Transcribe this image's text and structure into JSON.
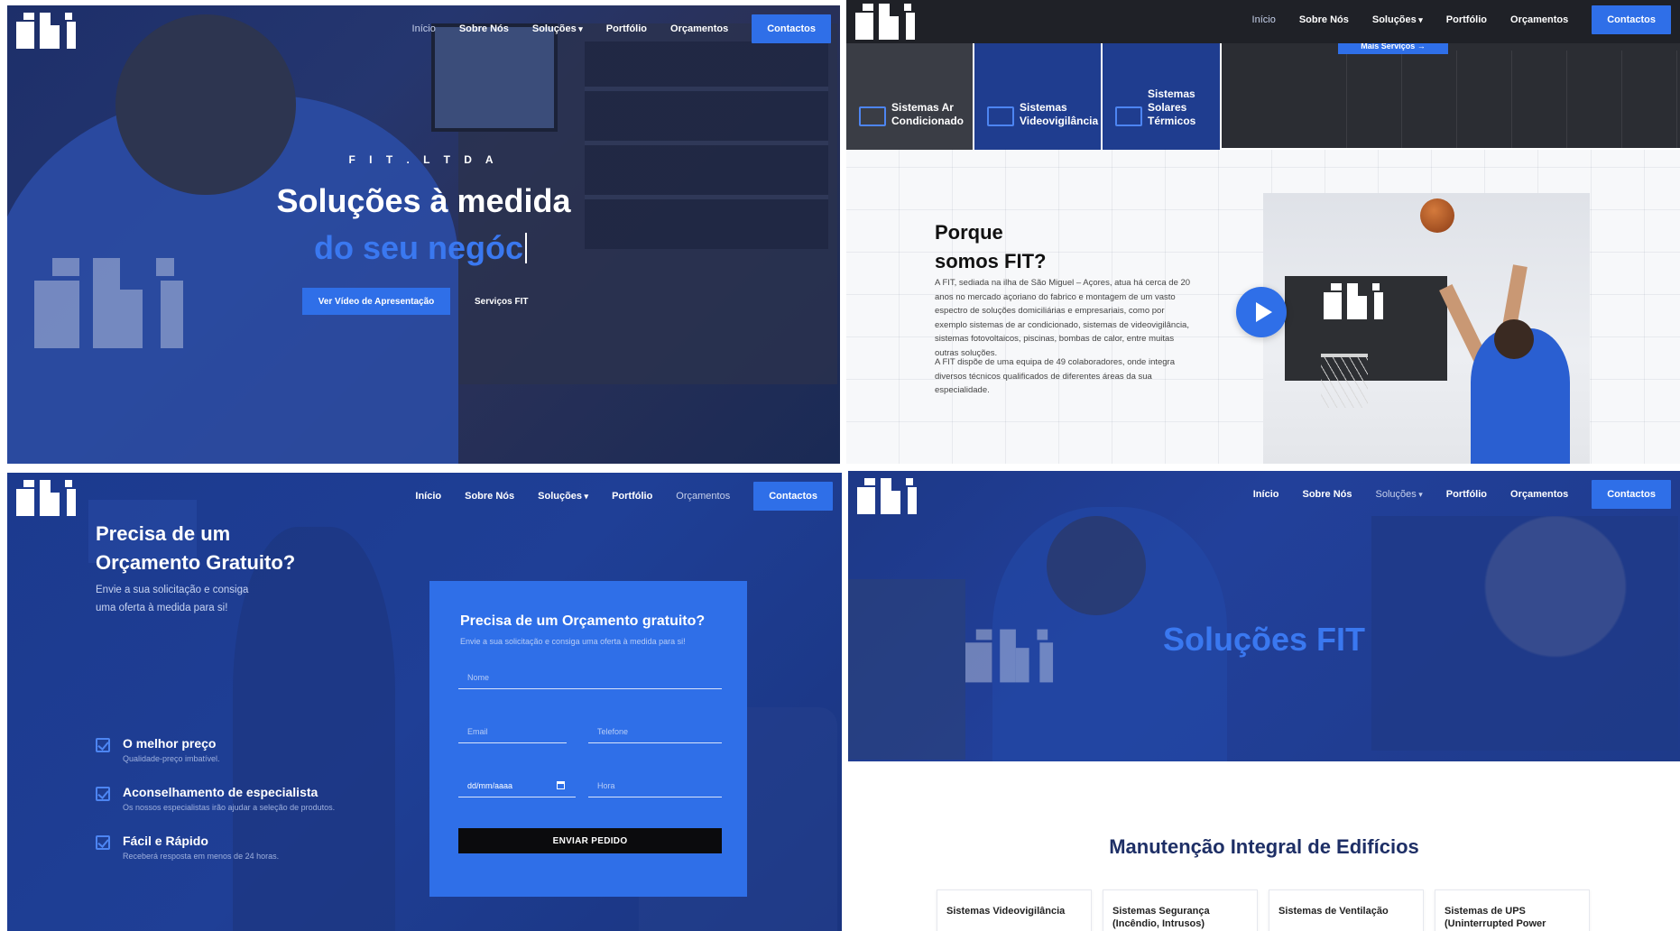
{
  "nav": {
    "items": [
      "Início",
      "Sobre Nós",
      "Soluções",
      "Portfólio",
      "Orçamentos"
    ],
    "cta": "Contactos"
  },
  "panel1": {
    "brand": "F I T . L T D A",
    "headline": "Soluções à medida",
    "typed": "do seu negóc",
    "btn_video": "Ver Vídeo de Apresentação",
    "btn_services": "Serviços FIT"
  },
  "panel2": {
    "more_services": "Mais Serviços →",
    "cards": [
      {
        "label": "Sistemas Ar\nCondicionado"
      },
      {
        "label": "Sistemas\nVideovigilância"
      },
      {
        "label": "Sistemas\nSolares\nTérmicos"
      }
    ],
    "why_title_1": "Porque",
    "why_title_2": "somos FIT?",
    "para1": "A FIT, sediada na ilha de São Miguel – Açores, atua há cerca de 20 anos no mercado açoriano do fabrico e montagem de um vasto espectro de soluções domiciliárias e empresariais, como por exemplo sistemas de ar condicionado, sistemas de videovigilância, sistemas fotovoltaicos, piscinas, bombas de calor, entre muitas outras soluções.",
    "para2": "A FIT dispõe de uma equipa de 49 colaboradores, onde integra diversos técnicos qualificados de diferentes áreas da sua especialidade."
  },
  "panel3": {
    "title_1": "Precisa de um",
    "title_2": "Orçamento Gratuito?",
    "subtitle_1": "Envie a sua solicitação e consiga",
    "subtitle_2": "uma oferta à medida para si!",
    "features": [
      {
        "title": "O melhor preço",
        "desc": "Qualidade-preço imbatível."
      },
      {
        "title": "Aconselhamento de especialista",
        "desc": "Os nossos especialistas irão ajudar a seleção de produtos."
      },
      {
        "title": "Fácil e Rápido",
        "desc": "Receberá resposta em menos de 24 horas."
      }
    ],
    "form": {
      "title": "Precisa de um Orçamento gratuito?",
      "subtitle": "Envie a sua solicitação e consiga uma oferta à medida para si!",
      "name": "Nome",
      "email": "Email",
      "phone": "Telefone",
      "date": "dd/mm/aaaa",
      "hour": "Hora",
      "submit": "ENVIAR PEDIDO"
    }
  },
  "panel4": {
    "title": "Soluções FIT",
    "section_title": "Manutenção Integral de Edifícios",
    "cards": [
      "Sistemas Videovigilância",
      "Sistemas Segurança (Incêndio, Intrusos)",
      "Sistemas de Ventilação",
      "Sistemas de UPS (Uninterrupted Power"
    ]
  },
  "colors": {
    "accent": "#2f6fe8",
    "dark": "#1f2127",
    "hero_blue": "#1f3f96"
  }
}
